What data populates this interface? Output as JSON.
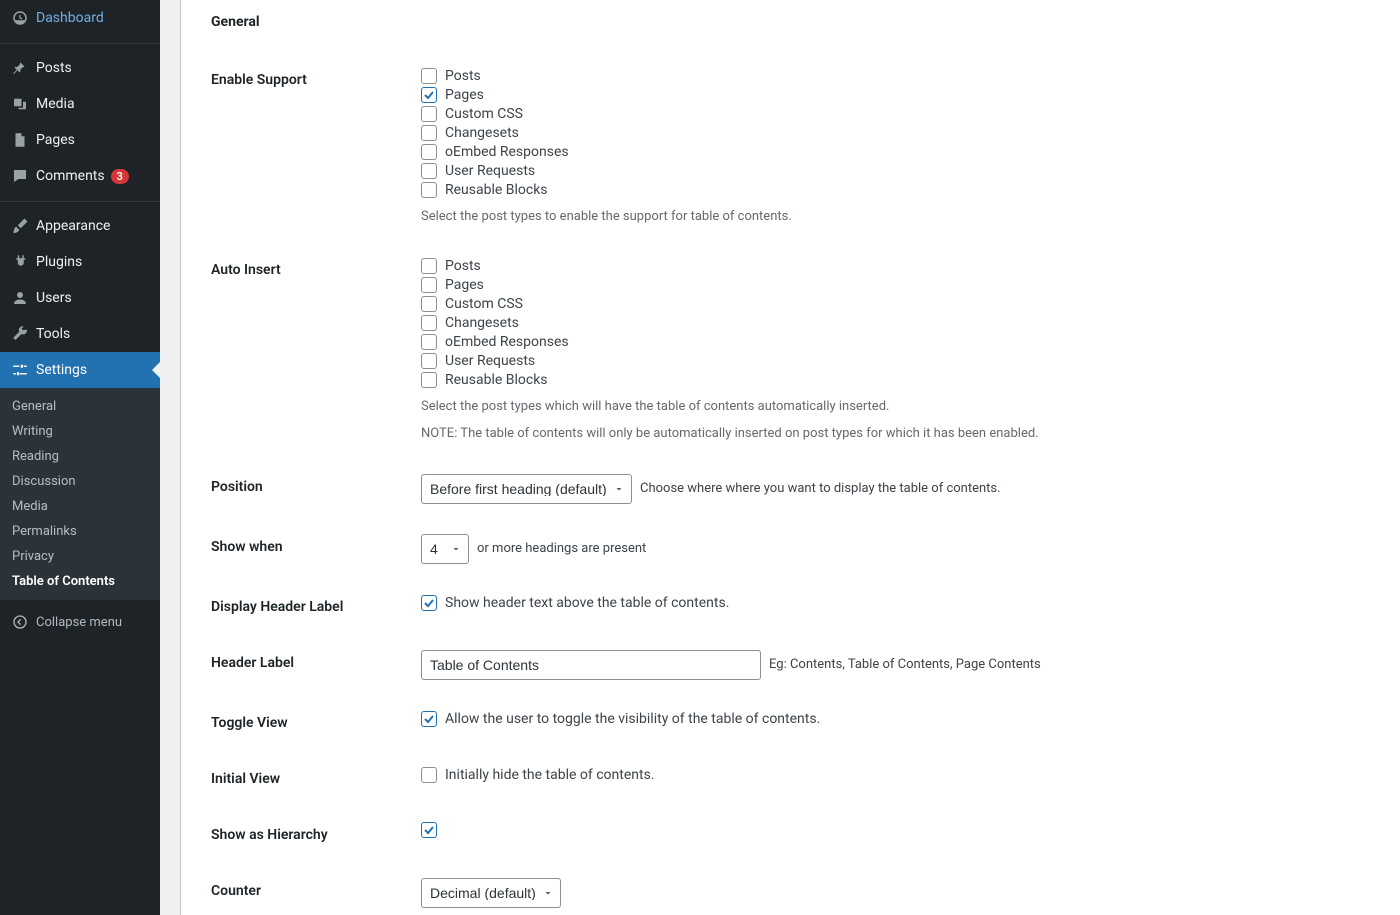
{
  "sidebar": {
    "items": [
      {
        "label": "Dashboard"
      },
      {
        "label": "Posts"
      },
      {
        "label": "Media"
      },
      {
        "label": "Pages"
      },
      {
        "label": "Comments",
        "badge": "3"
      },
      {
        "label": "Appearance"
      },
      {
        "label": "Plugins"
      },
      {
        "label": "Users"
      },
      {
        "label": "Tools"
      },
      {
        "label": "Settings"
      }
    ],
    "submenu": [
      {
        "label": "General"
      },
      {
        "label": "Writing"
      },
      {
        "label": "Reading"
      },
      {
        "label": "Discussion"
      },
      {
        "label": "Media"
      },
      {
        "label": "Permalinks"
      },
      {
        "label": "Privacy"
      },
      {
        "label": "Table of Contents",
        "current": true
      }
    ],
    "collapse": "Collapse menu"
  },
  "section_title": "General",
  "rows": {
    "enable_support": {
      "label": "Enable Support",
      "options": [
        {
          "label": "Posts",
          "checked": false
        },
        {
          "label": "Pages",
          "checked": true
        },
        {
          "label": "Custom CSS",
          "checked": false
        },
        {
          "label": "Changesets",
          "checked": false
        },
        {
          "label": "oEmbed Responses",
          "checked": false
        },
        {
          "label": "User Requests",
          "checked": false
        },
        {
          "label": "Reusable Blocks",
          "checked": false
        }
      ],
      "desc": "Select the post types to enable the support for table of contents."
    },
    "auto_insert": {
      "label": "Auto Insert",
      "options": [
        {
          "label": "Posts",
          "checked": false
        },
        {
          "label": "Pages",
          "checked": false
        },
        {
          "label": "Custom CSS",
          "checked": false
        },
        {
          "label": "Changesets",
          "checked": false
        },
        {
          "label": "oEmbed Responses",
          "checked": false
        },
        {
          "label": "User Requests",
          "checked": false
        },
        {
          "label": "Reusable Blocks",
          "checked": false
        }
      ],
      "desc": "Select the post types which will have the table of contents automatically inserted.",
      "note": "NOTE: The table of contents will only be automatically inserted on post types for which it has been enabled."
    },
    "position": {
      "label": "Position",
      "value": "Before first heading (default)",
      "desc": "Choose where where you want to display the table of contents."
    },
    "show_when": {
      "label": "Show when",
      "value": "4",
      "desc": "or more headings are present"
    },
    "display_header_label": {
      "label": "Display Header Label",
      "checked": true,
      "text": "Show header text above the table of contents."
    },
    "header_label": {
      "label": "Header Label",
      "value": "Table of Contents",
      "desc": "Eg: Contents, Table of Contents, Page Contents"
    },
    "toggle_view": {
      "label": "Toggle View",
      "checked": true,
      "text": "Allow the user to toggle the visibility of the table of contents."
    },
    "initial_view": {
      "label": "Initial View",
      "checked": false,
      "text": "Initially hide the table of contents."
    },
    "show_hierarchy": {
      "label": "Show as Hierarchy",
      "checked": true
    },
    "counter": {
      "label": "Counter",
      "value": "Decimal (default)"
    }
  }
}
